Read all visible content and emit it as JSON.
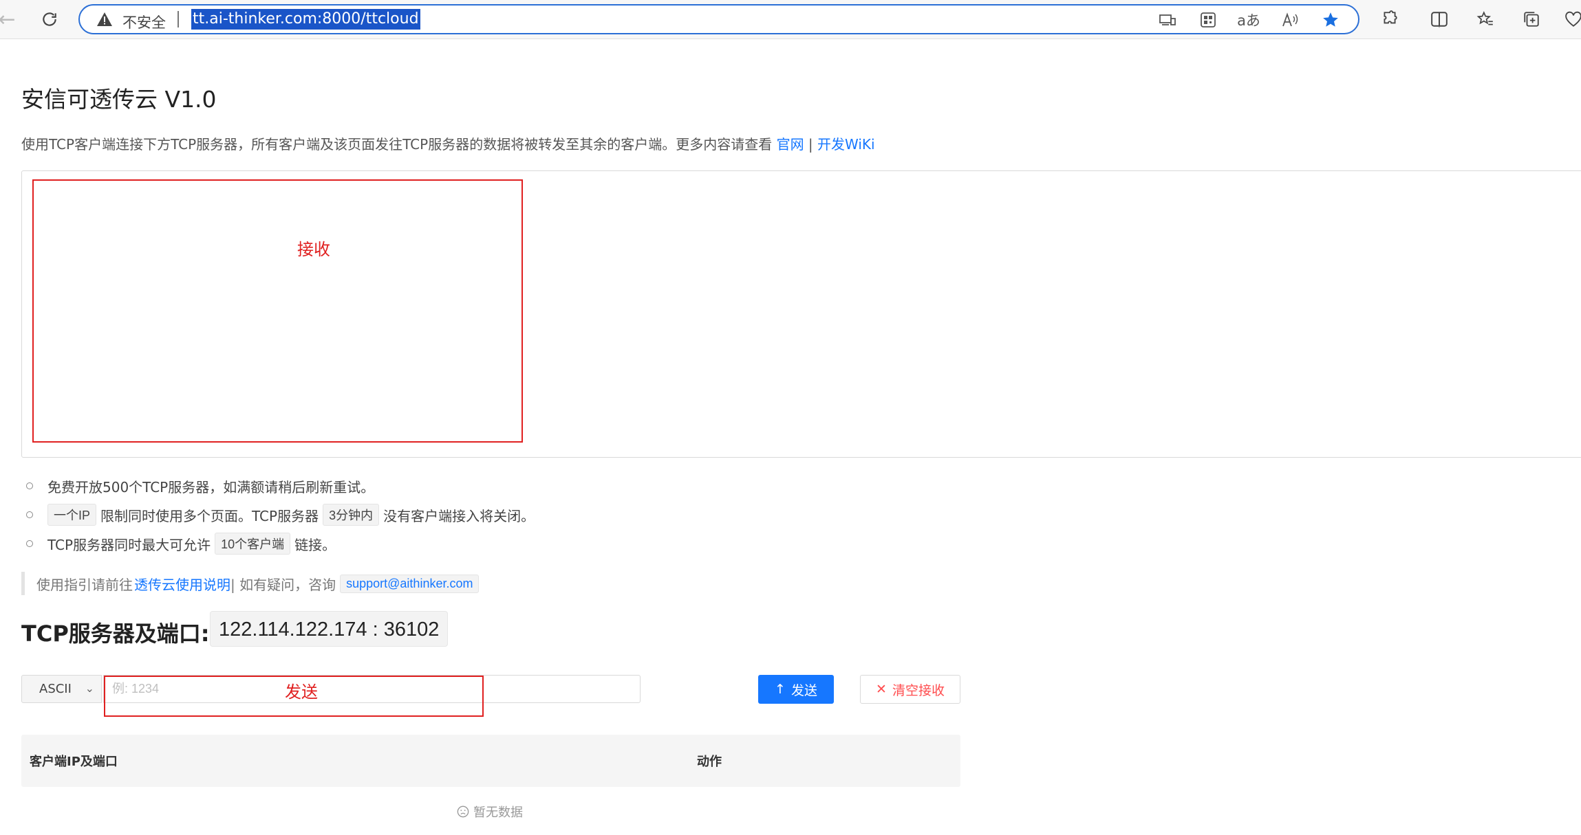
{
  "browser": {
    "security_label": "不安全",
    "url": "tt.ai-thinker.com:8000/ttcloud",
    "translate_icon_text": "aあ",
    "read_aloud_icon_text": "A̅"
  },
  "page": {
    "title": "安信可透传云 V1.0",
    "intro_text": "使用TCP客户端连接下方TCP服务器，所有客户端及该页面发往TCP服务器的数据将被转发至其余的客户端。更多内容请查看",
    "link_official": "官网",
    "link_separator": " | ",
    "link_wiki": "开发WiKi",
    "annotation_receive": "接收",
    "notes": {
      "n1": "免费开放500个TCP服务器，如满额请稍后刷新重试。",
      "n2_code1": "一个IP",
      "n2_text1": "限制同时使用多个页面。TCP服务器",
      "n2_code2": "3分钟内",
      "n2_text2": "没有客户端接入将关闭。",
      "n3_text1": "TCP服务器同时最大可允许",
      "n3_code": "10个客户端",
      "n3_text2": "链接。"
    },
    "guide": {
      "prefix": "使用指引请前往",
      "link": "透传云使用说明",
      "middle": " | 如有疑问，咨询",
      "email": "support@aithinker.com"
    },
    "server": {
      "label": "TCP服务器及端口:",
      "address": "122.114.122.174 : 36102"
    },
    "send": {
      "mode": "ASCII",
      "placeholder": "例: 1234",
      "annotation": "发送",
      "send_label": "发送",
      "clear_label": "清空接收"
    },
    "table": {
      "col_client": "客户端IP及端口",
      "col_action": "动作",
      "empty_text": "暂无数据"
    }
  },
  "colors": {
    "accent": "#1677ff",
    "danger": "#ff4d4f",
    "annotation": "#e02020"
  }
}
